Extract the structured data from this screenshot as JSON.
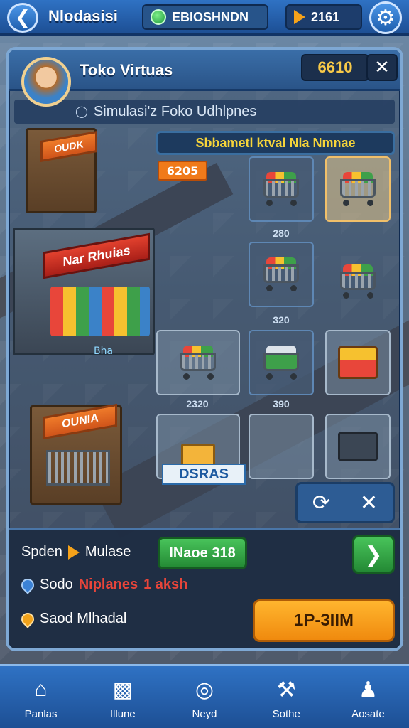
{
  "topbar": {
    "title": "Nlodasisi",
    "green_pill": "EBIOSHNDN",
    "gold_pill": "2161"
  },
  "panel": {
    "shop_name": "Toko Virtuas",
    "balance": "6610",
    "subtitle": "Simulasi'z Foko Udhlpnes",
    "section_title": "Sbbametl ktval Nla Nmnae",
    "price_tag": "6205",
    "store_signs": [
      "OUDK",
      "Nar Rhuias",
      "OUNIA"
    ],
    "road_label": "Bha",
    "items": [
      {
        "price": "280"
      },
      {
        "price": ""
      },
      {
        "price": "320"
      },
      {
        "price": ""
      },
      {
        "price": "2320"
      },
      {
        "price": "390"
      },
      {
        "price": ""
      },
      {
        "price": ""
      },
      {
        "price": ""
      }
    ],
    "mini_badge": "DSRAS"
  },
  "info": {
    "row1_label": "Spden",
    "row1_value": "Mulase",
    "row1_button": "INaoe 318",
    "row2_label": "Sodo",
    "row2_accent": "Niplanes",
    "row2_value": "1 aksh",
    "row3_label": "Saod Mlhadal",
    "big_button": "1P-3IIM"
  },
  "nav": [
    {
      "label": "Panlas",
      "icon": "shop-icon"
    },
    {
      "label": "Illune",
      "icon": "chart-icon"
    },
    {
      "label": "Neyd",
      "icon": "target-icon"
    },
    {
      "label": "Sothe",
      "icon": "wrench-icon"
    },
    {
      "label": "Aosate",
      "icon": "profile-icon"
    }
  ],
  "colors": {
    "primary": "#2f72c4",
    "gold": "#f7c948",
    "green": "#48c35a",
    "orange": "#f08a0e",
    "red_accent": "#e8453a"
  }
}
